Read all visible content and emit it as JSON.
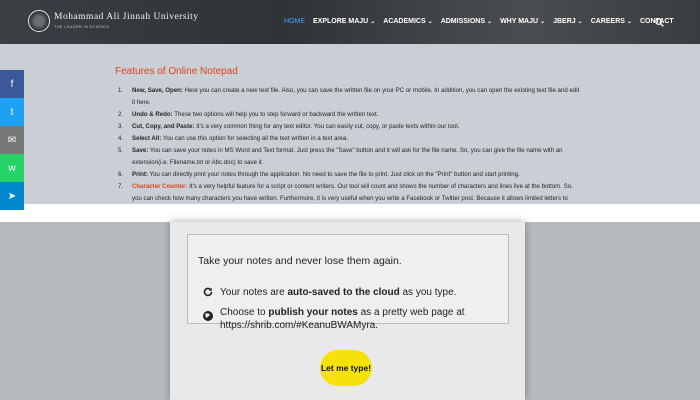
{
  "brand": {
    "title": "Mohammad Ali Jinnah University",
    "subtitle": "THE LEADER IN SCIENCE"
  },
  "nav": {
    "items": [
      {
        "label": "HOME",
        "has_chevron": false,
        "active": true
      },
      {
        "label": "EXPLORE MAJU",
        "has_chevron": true
      },
      {
        "label": "ACADEMICS",
        "has_chevron": true
      },
      {
        "label": "ADMISSIONS",
        "has_chevron": true
      },
      {
        "label": "WHY MAJU",
        "has_chevron": true
      },
      {
        "label": "JBERJ",
        "has_chevron": true
      },
      {
        "label": "CAREERS",
        "has_chevron": true
      },
      {
        "label": "CONTACT",
        "has_chevron": false
      }
    ]
  },
  "section": {
    "title": "Features of Online Notepad",
    "features": [
      {
        "num": "1.",
        "label": "New, Save, Open:",
        "text": " Here you can create a new text file. Also, you can save the written file on your PC or mobile. In addition, you can open the existing text file and edit it here."
      },
      {
        "num": "2.",
        "label": "Undo & Redo:",
        "text": " These two options will help you to step forward or backward the written text."
      },
      {
        "num": "3.",
        "label": "Cut, Copy, and Paste:",
        "text": " It's a very common thing for any text editor. You can easily cut, copy, or paste texts within our tool."
      },
      {
        "num": "4.",
        "label": "Select All:",
        "text": " You can use this option for selecting all the text written in a text area."
      },
      {
        "num": "5.",
        "label": "Save:",
        "text": " You can save your notes in MS Word and Text format. Just press the \"Save\" button and it will ask for the file name. So, you can give the file name with an extension(i.e. Filename.txt or Abc.doc) to save it."
      },
      {
        "num": "6.",
        "label": "Print:",
        "text": " You can directly print your notes through the application. No need to save the file to print. Just click on the \"Print\" button and start printing."
      },
      {
        "num": "7.",
        "label": "Character Counter:",
        "text": " It's a very helpful feature for a script or content writers. Our tool will count and shows the number of characters and lines live at the bottom. So, you can check how many characters you have written. Furthermore, it is very useful when you write a Facebook or Twitter post. Because it allows limited letters to submit a post."
      }
    ]
  },
  "social": [
    "f",
    "t",
    "✉",
    "w",
    "➤"
  ],
  "promo": {
    "tagline": "Take your notes and never lose them again.",
    "item1_pre": "Your notes are ",
    "item1_bold": "auto-saved to the cloud",
    "item1_post": " as you type.",
    "item2_pre": "Choose to ",
    "item2_bold": "publish your notes",
    "item2_post": " as a pretty web page at",
    "item2_url": "https://shrib.com/#KeanuBWAMyra.",
    "cta": "Let me type!"
  }
}
